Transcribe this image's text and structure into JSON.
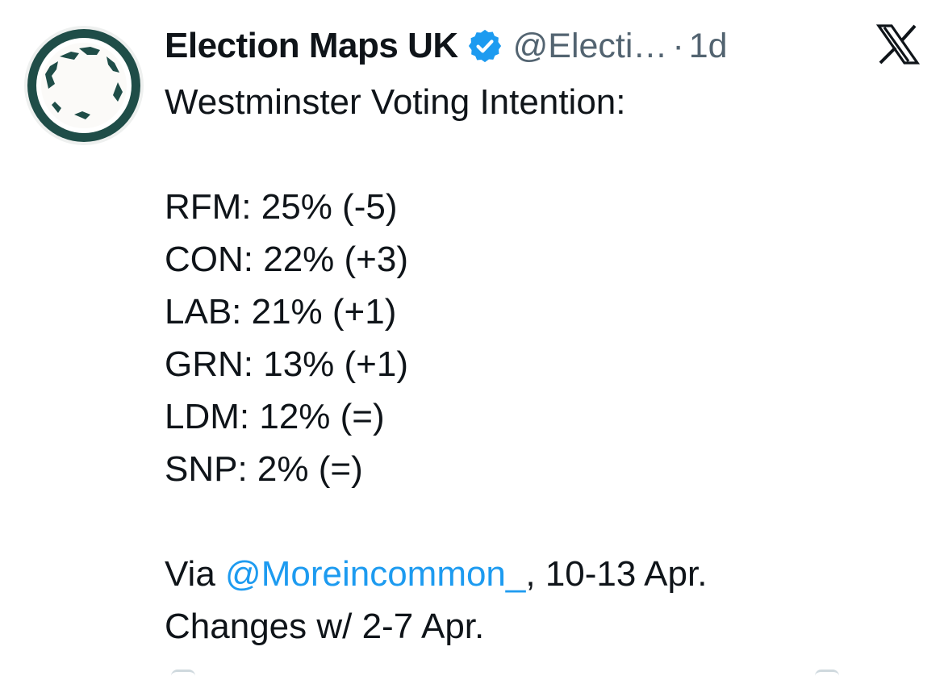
{
  "tweet": {
    "author": {
      "display_name": "Election Maps UK",
      "handle": "@Electi…",
      "separator": "·",
      "time": "1d",
      "verified_icon": "verified-badge-icon",
      "avatar_icon": "election-maps-logo",
      "avatar_color": "#1f4d48"
    },
    "platform_icon": "x-logo-icon",
    "text": {
      "heading": "Westminster Voting Intention:",
      "polls": [
        {
          "line": "RFM: 25% (-5)"
        },
        {
          "line": "CON: 22% (+3)"
        },
        {
          "line": "LAB: 21% (+1)"
        },
        {
          "line": "GRN: 13% (+1)"
        },
        {
          "line": "LDM: 12% (=)"
        },
        {
          "line": "SNP: 2% (=)"
        }
      ],
      "via_prefix": "Via ",
      "via_mention": "@Moreincommon_",
      "via_suffix": ", 10-13 Apr.",
      "changes_line": "Changes w/ 2-7 Apr."
    },
    "colors": {
      "text": "#0f1419",
      "secondary": "#536471",
      "link": "#1d9bf0",
      "verified": "#1d9bf0"
    }
  }
}
